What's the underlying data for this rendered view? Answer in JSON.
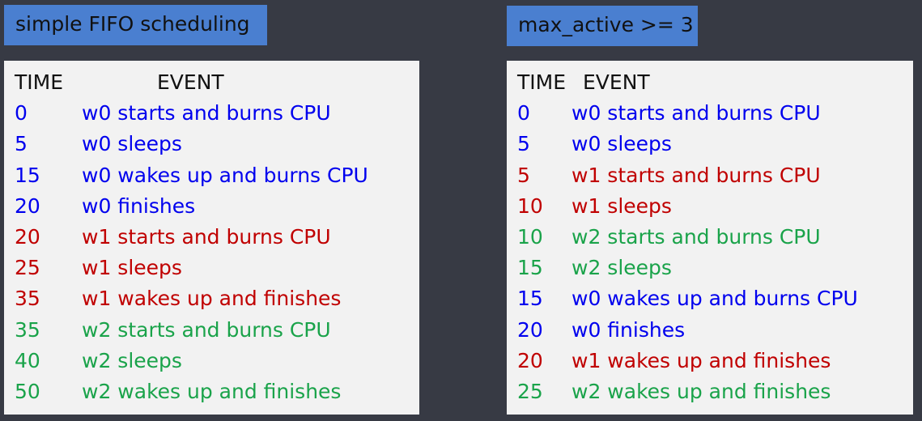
{
  "colors": {
    "background": "#373a44",
    "title_bg": "#4a7fd0",
    "panel_bg": "#f2f2f2",
    "w0": "#0000ee",
    "w1": "#c00000",
    "w2": "#1aa34a"
  },
  "left": {
    "title": "simple FIFO scheduling",
    "col_time": "TIME",
    "col_event": "EVENT",
    "rows": [
      {
        "time": "0",
        "event": "w0 starts and burns CPU",
        "worker": "w0"
      },
      {
        "time": "5",
        "event": "w0 sleeps",
        "worker": "w0"
      },
      {
        "time": "15",
        "event": "w0 wakes up and burns CPU",
        "worker": "w0"
      },
      {
        "time": "20",
        "event": "w0 finishes",
        "worker": "w0"
      },
      {
        "time": "20",
        "event": "w1 starts and burns CPU",
        "worker": "w1"
      },
      {
        "time": "25",
        "event": "w1 sleeps",
        "worker": "w1"
      },
      {
        "time": "35",
        "event": "w1 wakes up and finishes",
        "worker": "w1"
      },
      {
        "time": "35",
        "event": "w2 starts and burns CPU",
        "worker": "w2"
      },
      {
        "time": "40",
        "event": "w2 sleeps",
        "worker": "w2"
      },
      {
        "time": "50",
        "event": "w2 wakes up and finishes",
        "worker": "w2"
      }
    ]
  },
  "right": {
    "title": "max_active >= 3",
    "col_time": "TIME",
    "col_event": "EVENT",
    "rows": [
      {
        "time": "0",
        "event": "w0 starts and burns CPU",
        "worker": "w0"
      },
      {
        "time": "5",
        "event": "w0 sleeps",
        "worker": "w0"
      },
      {
        "time": "5",
        "event": "w1 starts and burns CPU",
        "worker": "w1"
      },
      {
        "time": "10",
        "event": "w1 sleeps",
        "worker": "w1"
      },
      {
        "time": "10",
        "event": "w2 starts and burns CPU",
        "worker": "w2"
      },
      {
        "time": "15",
        "event": "w2 sleeps",
        "worker": "w2"
      },
      {
        "time": "15",
        "event": "w0 wakes up and burns CPU",
        "worker": "w0"
      },
      {
        "time": "20",
        "event": "w0 finishes",
        "worker": "w0"
      },
      {
        "time": "20",
        "event": "w1 wakes up and finishes",
        "worker": "w1"
      },
      {
        "time": "25",
        "event": "w2 wakes up and finishes",
        "worker": "w2"
      }
    ]
  }
}
